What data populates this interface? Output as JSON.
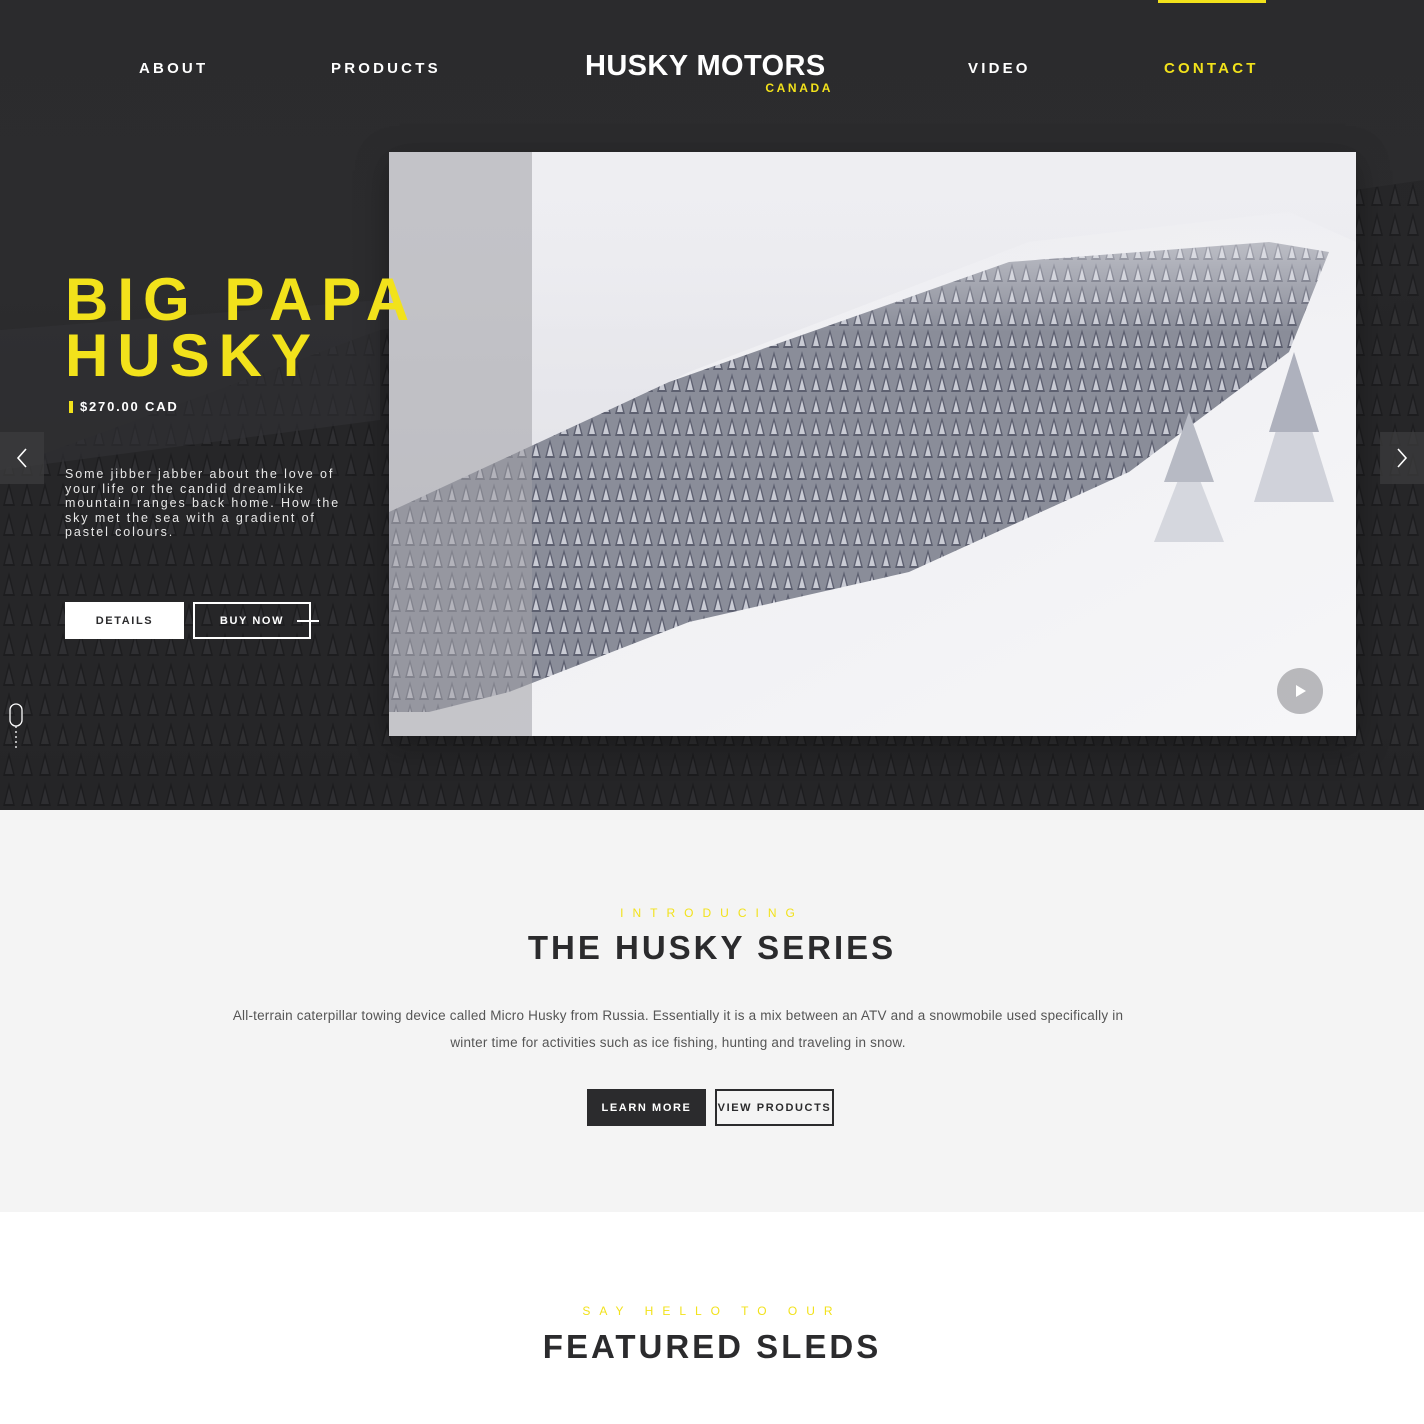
{
  "colors": {
    "accent": "#f2e21b",
    "dark": "#2b2b2d",
    "light_bg": "#f4f4f4"
  },
  "nav": {
    "items": [
      {
        "label": "ABOUT"
      },
      {
        "label": "PRODUCTS"
      },
      {
        "label": "VIDEO"
      },
      {
        "label": "CONTACT",
        "active": true
      }
    ],
    "logo": {
      "main": "HUSKY MOTORS",
      "sub": "CANADA"
    }
  },
  "hero": {
    "title_line1": "BIG PAPA",
    "title_line2": "HUSKY",
    "price": "$270.00 CAD",
    "description": "Some jibber jabber about the love of your life or the candid dreamlike mountain ranges back home. How the sky met the sea with a gradient of pastel colours.",
    "details_label": "DETAILS",
    "buy_label": "BUY NOW",
    "icons": {
      "prev": "chevron-left-icon",
      "next": "chevron-right-icon",
      "play": "play-icon",
      "scroll": "mouse-scroll-icon"
    }
  },
  "intro": {
    "eyebrow": "INTRODUCING",
    "title": "THE HUSKY SERIES",
    "text_line1": "All-terrain caterpillar towing device called Micro Husky from Russia. Essentially it is a mix between an ATV and a snowmobile used specifically in",
    "text_line2": "winter time for activities such as ice fishing, hunting and traveling in snow.",
    "learn_more_label": "LEARN MORE",
    "view_products_label": "VIEW PRODUCTS"
  },
  "featured": {
    "eyebrow": "SAY HELLO TO OUR",
    "title": "FEATURED SLEDS"
  }
}
